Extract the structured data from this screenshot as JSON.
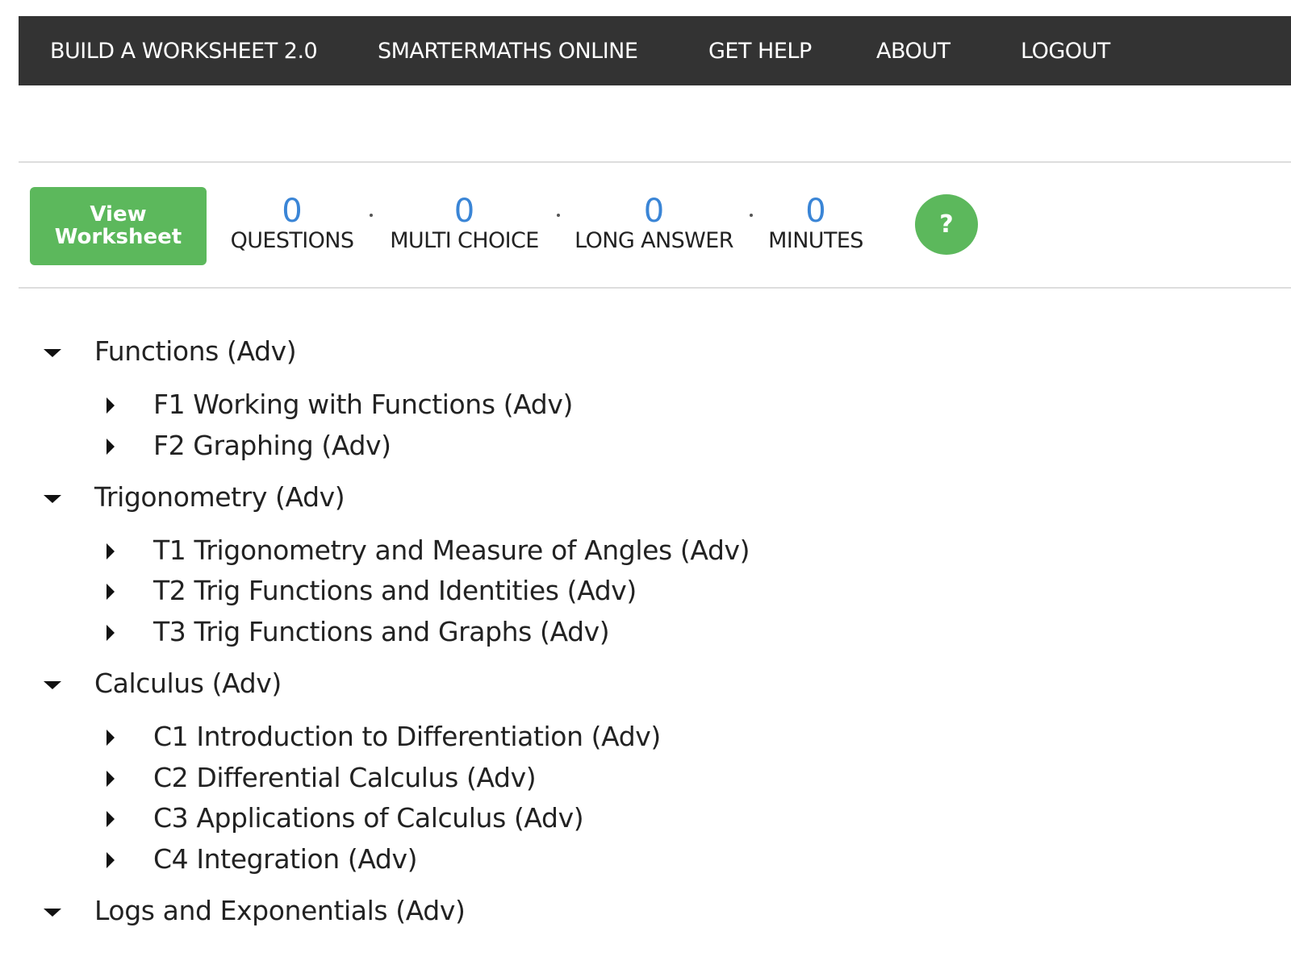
{
  "nav": {
    "items": [
      {
        "label": "BUILD A WORKSHEET 2.0"
      },
      {
        "label": "SMARTERMATHS ONLINE"
      },
      {
        "label": "GET HELP"
      },
      {
        "label": "ABOUT"
      },
      {
        "label": "LOGOUT"
      }
    ]
  },
  "toolbar": {
    "view_worksheet_label": "View Worksheet",
    "stats": [
      {
        "value": "0",
        "label": "QUESTIONS"
      },
      {
        "value": "0",
        "label": "MULTI CHOICE"
      },
      {
        "value": "0",
        "label": "LONG ANSWER"
      },
      {
        "value": "0",
        "label": "MINUTES"
      }
    ],
    "help_label": "?"
  },
  "colors": {
    "navbar_bg": "#333333",
    "accent_green": "#5cb85c",
    "stat_blue": "#3a85d6"
  },
  "topics": [
    {
      "label": "Functions (Adv)",
      "expanded": true,
      "children": [
        {
          "label": "F1 Working with Functions (Adv)"
        },
        {
          "label": "F2 Graphing (Adv)"
        }
      ]
    },
    {
      "label": "Trigonometry (Adv)",
      "expanded": true,
      "children": [
        {
          "label": "T1 Trigonometry and Measure of Angles (Adv)"
        },
        {
          "label": "T2 Trig Functions and Identities (Adv)"
        },
        {
          "label": "T3 Trig Functions and Graphs (Adv)"
        }
      ]
    },
    {
      "label": "Calculus (Adv)",
      "expanded": true,
      "children": [
        {
          "label": "C1 Introduction to Differentiation (Adv)"
        },
        {
          "label": "C2 Differential Calculus (Adv)"
        },
        {
          "label": "C3 Applications of Calculus (Adv)"
        },
        {
          "label": "C4 Integration (Adv)"
        }
      ]
    },
    {
      "label": "Logs and Exponentials (Adv)",
      "expanded": true,
      "children": []
    }
  ]
}
